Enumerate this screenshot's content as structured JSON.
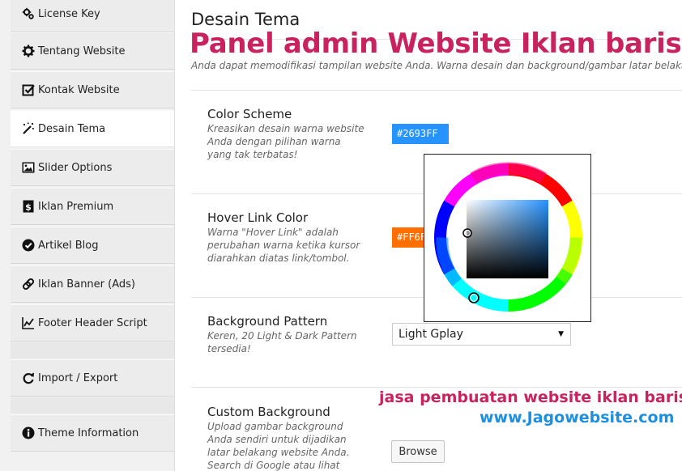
{
  "sidebar": {
    "items": [
      {
        "label": "License Key",
        "icon": "gears-icon"
      },
      {
        "label": "Tentang Website",
        "icon": "gear-icon"
      },
      {
        "label": "Kontak Website",
        "icon": "checkbox-icon"
      },
      {
        "label": "Desain Tema",
        "icon": "magic-wand-icon",
        "active": true
      },
      {
        "label": "Slider Options",
        "icon": "image-icon"
      },
      {
        "label": "Iklan Premium",
        "icon": "dollar-icon"
      },
      {
        "label": "Artikel Blog",
        "icon": "check-circle-icon"
      },
      {
        "label": "Iklan Banner (Ads)",
        "icon": "link-icon"
      },
      {
        "label": "Footer Header Script",
        "icon": "line-chart-icon"
      },
      {
        "label": "Import / Export",
        "icon": "refresh-icon"
      },
      {
        "label": "Theme Information",
        "icon": "info-icon"
      }
    ]
  },
  "main": {
    "title": "Desain Tema",
    "overlay_title": "Panel admin Website Iklan baris",
    "description": "Anda dapat memodifikasi tampilan website Anda. Warna desain dan background/gambar latar belakang.",
    "options": {
      "color_scheme": {
        "label": "Color Scheme",
        "desc": "Kreasikan desain warna website Anda dengan pilihan warna yang tak terbatas!",
        "value": "#2693FF"
      },
      "hover_link": {
        "label": "Hover Link Color",
        "desc": "Warna \"Hover Link\" adalah perubahan warna ketika kursor diarahkan diatas link/tombol.",
        "value": "#FF6F"
      },
      "bg_pattern": {
        "label": "Background Pattern",
        "desc": "Keren, 20 Light & Dark Pattern tersedia!",
        "selected": "Light Gplay"
      },
      "custom_bg": {
        "label": "Custom Background",
        "desc": "Upload gambar background Anda sendiri untuk dijadikan latar belakang website Anda. Search di Google atau lihat",
        "button": "Browse"
      }
    }
  },
  "watermark": {
    "line1": "jasa pembuatan website iklan baris",
    "line2": "www.Jagowebsite.com"
  },
  "colors": {
    "accent": "#c8235f",
    "link_blue": "#1e8fe0",
    "scheme_swatch": "#2693FF",
    "hover_swatch": "#FF6F00"
  }
}
